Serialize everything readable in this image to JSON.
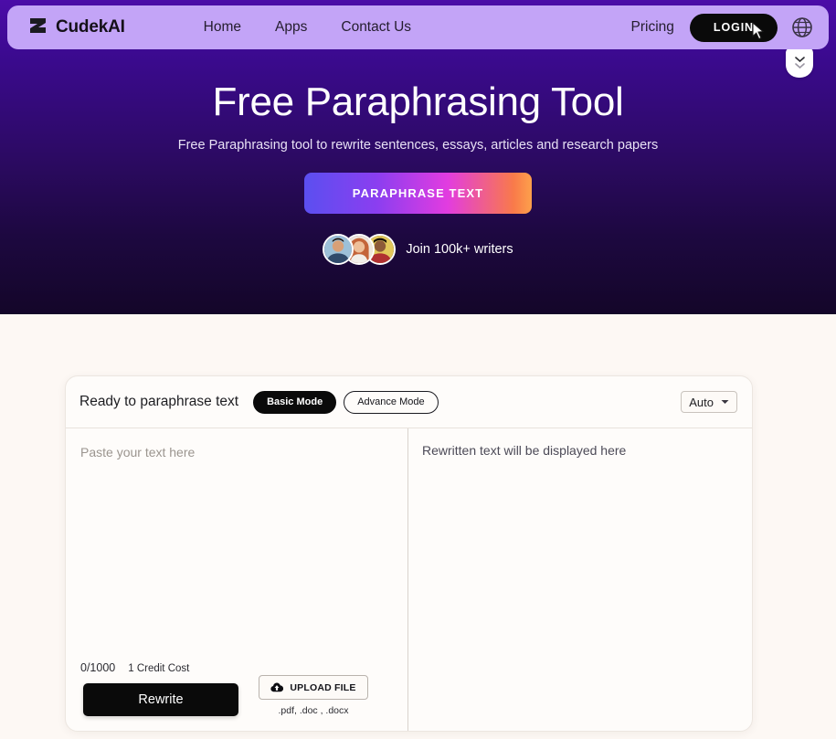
{
  "nav": {
    "brand": "CudekAI",
    "brand_icon": "z-logo-icon",
    "links": [
      {
        "label": "Home"
      },
      {
        "label": "Apps"
      },
      {
        "label": "Contact Us"
      }
    ],
    "pricing_label": "Pricing",
    "login_label": "LOGIN",
    "globe_icon": "globe-icon",
    "collapse_icon": "double-chevron-down-icon",
    "bg_color": "#c3a4f7"
  },
  "hero": {
    "title": "Free Paraphrasing Tool",
    "subtitle": "Free Paraphrasing tool to rewrite sentences, essays, articles and research papers",
    "cta_label": "PARAPHRASE TEXT",
    "social_proof": "Join 100k+ writers",
    "gradient_top": "#4b0ca8",
    "gradient_bottom": "#140629"
  },
  "card": {
    "title": "Ready to paraphrase text",
    "modes": [
      {
        "label": "Basic Mode",
        "active": true
      },
      {
        "label": "Advance Mode",
        "active": false
      }
    ],
    "language_selected": "Auto",
    "input_placeholder": "Paste your text here",
    "output_placeholder": "Rewritten text will be displayed here",
    "char_counter": "0/1000",
    "credit_cost": "1 Credit Cost",
    "rewrite_label": "Rewrite",
    "upload_label": "UPLOAD FILE",
    "upload_icon": "cloud-upload-icon",
    "file_types": ".pdf, .doc , .docx"
  }
}
